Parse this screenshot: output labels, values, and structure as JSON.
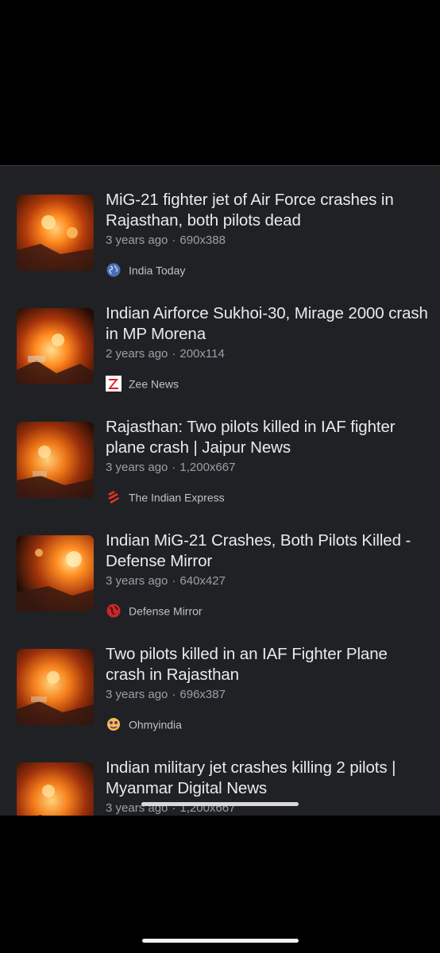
{
  "results": [
    {
      "title": "MiG-21 fighter jet of Air Force crashes in Rajasthan, both pilots dead",
      "age": "3 years ago",
      "dimensions": "690x388",
      "source": "India Today",
      "source_icon": "globe-icon"
    },
    {
      "title": "Indian Airforce Sukhoi-30, Mirage 2000 crash in MP Morena",
      "age": "2 years ago",
      "dimensions": "200x114",
      "source": "Zee News",
      "source_icon": "zee-news-logo-icon"
    },
    {
      "title": "Rajasthan: Two pilots killed in IAF fighter plane crash | Jaipur News",
      "age": "3 years ago",
      "dimensions": "1,200x667",
      "source": "The Indian Express",
      "source_icon": "indian-express-logo-icon"
    },
    {
      "title": "Indian MiG-21 Crashes, Both Pilots Killed - Defense Mirror",
      "age": "3 years ago",
      "dimensions": "640x427",
      "source": "Defense Mirror",
      "source_icon": "defense-mirror-logo-icon"
    },
    {
      "title": "Two pilots killed in an IAF Fighter Plane crash in Rajasthan",
      "age": "3 years ago",
      "dimensions": "696x387",
      "source": "Ohmyindia",
      "source_icon": "ohmyindia-logo-icon"
    },
    {
      "title": "Indian military jet crashes killing 2 pilots | Myanmar Digital News",
      "age": "3 years ago",
      "dimensions": "1,200x667",
      "source": "",
      "source_icon": ""
    }
  ],
  "separator": "·",
  "colors": {
    "panel_background": "#202124",
    "title_text": "#e8eaed",
    "meta_text": "#9aa0a6",
    "fire_orange": "#ff7a1a"
  }
}
